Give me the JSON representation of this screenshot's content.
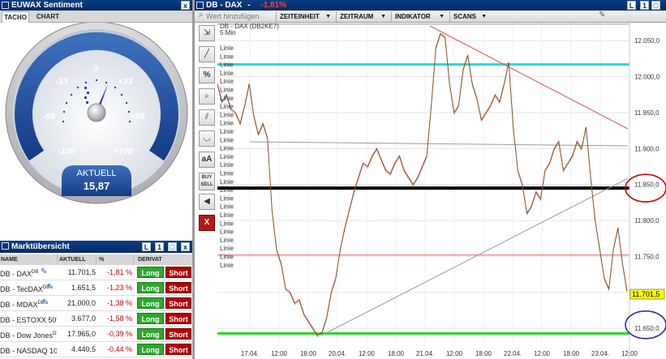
{
  "sentiment_panel": {
    "title": "EUWAX Sentiment",
    "tabs": [
      "TACHO",
      "CHART"
    ],
    "gauge": {
      "ticks": [
        "-100",
        "-66",
        "-33",
        "0",
        "+33",
        "+66",
        "+100"
      ],
      "value_label": "AKTUELL",
      "value": "15,87",
      "needle_value": 15.87
    }
  },
  "market_overview": {
    "title": "Marktübersicht",
    "columns": [
      "NAME",
      "AKTUELL",
      "%",
      "DERIVAT"
    ],
    "long_label": "Long",
    "short_label": "Short",
    "rows": [
      {
        "name": "DB - DAX",
        "sup": "DB",
        "value": "11.701,5",
        "pct": "-1,81 %",
        "edit": true
      },
      {
        "name": "DB - TecDAX",
        "sup": "DB",
        "value": "1.651,5",
        "pct": "-1,23 %",
        "edit": true
      },
      {
        "name": "DB - MDAX",
        "sup": "DB",
        "value": "21.000,0",
        "pct": "-1,38 %",
        "edit": true
      },
      {
        "name": "DB - ESTOXX 50",
        "sup": "DB",
        "value": "3.677,0",
        "pct": "-1,58 %",
        "edit": false
      },
      {
        "name": "DB - Dow Jones",
        "sup": "DB",
        "value": "17.965,0",
        "pct": "-0,39 %",
        "edit": false
      },
      {
        "name": "DB - NASDAQ 100",
        "sup": "c",
        "value": "4.440,5",
        "pct": "-0,44 %",
        "edit": false
      }
    ]
  },
  "chart_window": {
    "title": "DB - DAX",
    "title_dash": "-",
    "title_change": "-1,81%",
    "search_placeholder": "Wert hinzufügen",
    "menus": [
      "ZEITEINHEIT",
      "ZEITRAUM",
      "INDIKATOR",
      "SCANS"
    ],
    "instrument": "DB - DAX (DB2KE7)",
    "interval": "5 Min",
    "line_labels": [
      "Linie",
      "Linie",
      "Linie",
      "Linie",
      "Linie",
      "Linie",
      "Linie",
      "Linie",
      "Linie",
      "Linie",
      "Linie",
      "Linie",
      "Linie",
      "Linie",
      "Linie",
      "Linie",
      "Linie",
      "Linie",
      "Linie",
      "Linie",
      "Linie",
      "Linie",
      "Linie",
      "Linie",
      "Linie",
      "Linie",
      "Linie"
    ],
    "current_price": "11.701,5",
    "tools": [
      "cursor-tool",
      "line-tool",
      "percent-tool",
      "zoom-tool",
      "parallel-lines-tool",
      "curve-tool",
      "text-tool",
      "buy-sell-tool",
      "sound-tool",
      "delete-tool"
    ],
    "tool_labels": {
      "percent": "%",
      "text": "aA",
      "buy": "BUY",
      "sell": "SELL",
      "delete": "X"
    }
  },
  "chart_data": {
    "type": "line",
    "title": "",
    "y_ticks": [
      "12.050,0",
      "12.000,0",
      "11.950,0",
      "11.900,0",
      "11.850,0",
      "11.800,0",
      "11.750,0",
      "11.700,0",
      "11.650,0"
    ],
    "x_ticks": [
      "17.04.",
      "12:00",
      "18:00",
      "20.04.",
      "12:00",
      "18:00",
      "21.04.",
      "12:00",
      "18:00",
      "22.04.",
      "12:00",
      "18:00",
      "23.04.",
      "12:00"
    ],
    "ylim": [
      11630,
      12075
    ],
    "series": [
      {
        "values": [
          11990,
          11965,
          11975,
          11955,
          11950,
          11935,
          11960,
          11990,
          11945,
          11920,
          11935,
          11915,
          11815,
          11760,
          11740,
          11705,
          11700,
          11685,
          11690,
          11670,
          11660,
          11650,
          11640,
          11645,
          11665,
          11700,
          11720,
          11760,
          11790,
          11815,
          11840,
          11860,
          11880,
          11875,
          11890,
          11900,
          11885,
          11870,
          11865,
          11880,
          11890,
          11870,
          11860,
          11850,
          11860,
          11875,
          11890,
          11960,
          12040,
          12060,
          12055,
          11990,
          11950,
          11960,
          12010,
          12030,
          11990,
          11970,
          11940,
          11950,
          11960,
          11975,
          11965,
          11990,
          12020,
          11930,
          11870,
          11850,
          11810,
          11820,
          11840,
          11830,
          11870,
          11880,
          11900,
          11910,
          11870,
          11880,
          11890,
          11910,
          11900,
          11930,
          11860,
          11800,
          11760,
          11720,
          11705,
          11760,
          11790,
          11740,
          11701.5
        ]
      }
    ],
    "horizontal_lines": [
      {
        "value": 12017,
        "color": "#33d6d6",
        "label": "cyan"
      },
      {
        "value": 11845,
        "color": "#000000",
        "label": "black"
      },
      {
        "value": 11752,
        "color": "#e06060",
        "label": "red"
      },
      {
        "value": 11643,
        "color": "#22dd22",
        "label": "green"
      },
      {
        "value": 12073,
        "color": "#999999",
        "label": "grey-top"
      }
    ],
    "highlights": [
      {
        "value": 11845,
        "color": "#cc0000"
      },
      {
        "value": 11655,
        "color": "#2233aa"
      }
    ]
  },
  "colors": {
    "titlebar": "#0b3f86",
    "negative": "#cc0000",
    "long": "#2ea82e",
    "short": "#b30000"
  }
}
